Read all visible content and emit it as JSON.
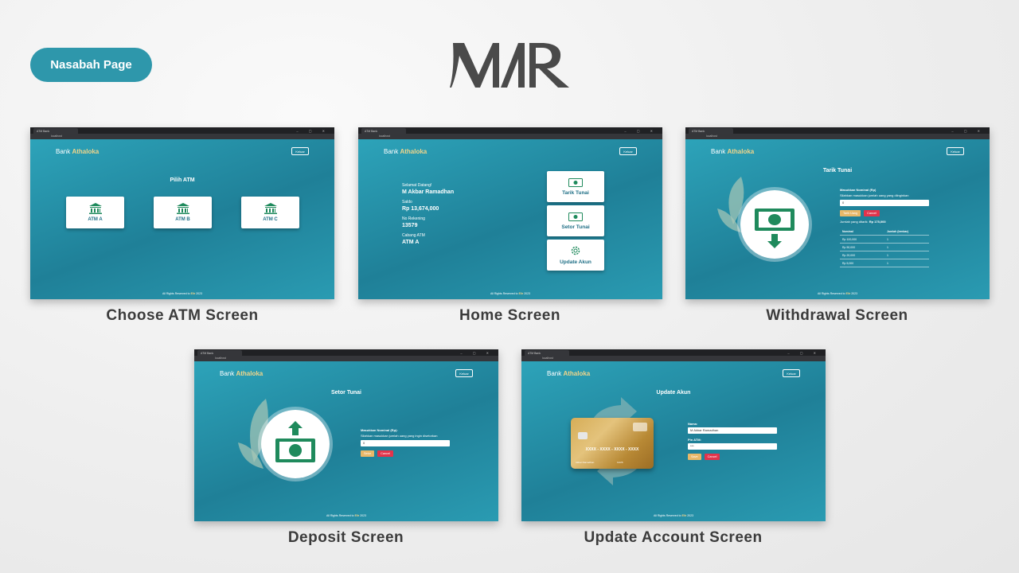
{
  "page_title": "Nasabah Page",
  "logo_text": "MAR",
  "captions": [
    "Choose ATM Screen",
    "Home Screen",
    "Withdrawal Screen",
    "Deposit Screen",
    "Update Account Screen"
  ],
  "colors": {
    "accent": "#2e97ab",
    "brand_gold": "#f2d58a",
    "danger": "#e2334b",
    "warning": "#e8b869"
  },
  "app": {
    "brand_prefix": "Bank",
    "brand_name": "Athaloka",
    "logout": "Keluar",
    "tab_title": "ATM Bank",
    "footer_prefix": "All Rights Reserved to",
    "footer_name": "Elir",
    "footer_year": "2023",
    "url_host": "localhost"
  },
  "choose": {
    "title": "Pilih ATM",
    "atms": [
      "ATM A",
      "ATM B",
      "ATM C"
    ]
  },
  "home": {
    "greeting_label": "Selamat Datang!",
    "name": "M Akbar Ramadhan",
    "balance_label": "Saldo",
    "balance": "Rp 13,674,000",
    "account_label": "No Rekening",
    "account": "13579",
    "branch_label": "Cabang ATM",
    "branch": "ATM A",
    "menu": [
      "Tarik Tunai",
      "Setor Tunai",
      "Update Akun"
    ]
  },
  "withdraw": {
    "title": "Tarik Tunai",
    "label": "Masukkan Nominal (Rp)",
    "hint": "Silahkan masukkan jumlah uang yang diinginkan",
    "value": "0",
    "submit": "Tarik Uang",
    "cancel": "Cancel",
    "total_label": "Jumlah yang ditarik:",
    "total": "Rp 175,000",
    "table_headers": [
      "Nominal",
      "Jumlah (lembar)"
    ],
    "rows": [
      [
        "Rp 100,000",
        "1"
      ],
      [
        "Rp 50,000",
        "1"
      ],
      [
        "Rp 20,000",
        "1"
      ],
      [
        "Rp 5,000",
        "1"
      ]
    ]
  },
  "deposit": {
    "title": "Setor Tunai",
    "label": "Masukkan Nominal (Rp):",
    "hint": "Silahkan masukkan jumlah uang yang ingin disetorkan",
    "value": "0",
    "submit": "Setor",
    "cancel": "Cancel"
  },
  "update": {
    "title": "Update Akun",
    "name_label": "Nama:",
    "name_value": "M Akbar Ramadhan",
    "pin_label": "Pin ATM:",
    "pin_value": "***",
    "submit": "Save",
    "cancel": "Cancel",
    "card_number": "XXXX - XXXX - XXXX - XXXX",
    "card_holder": "Akbar Ramadhan",
    "card_expiry": "12/26"
  }
}
